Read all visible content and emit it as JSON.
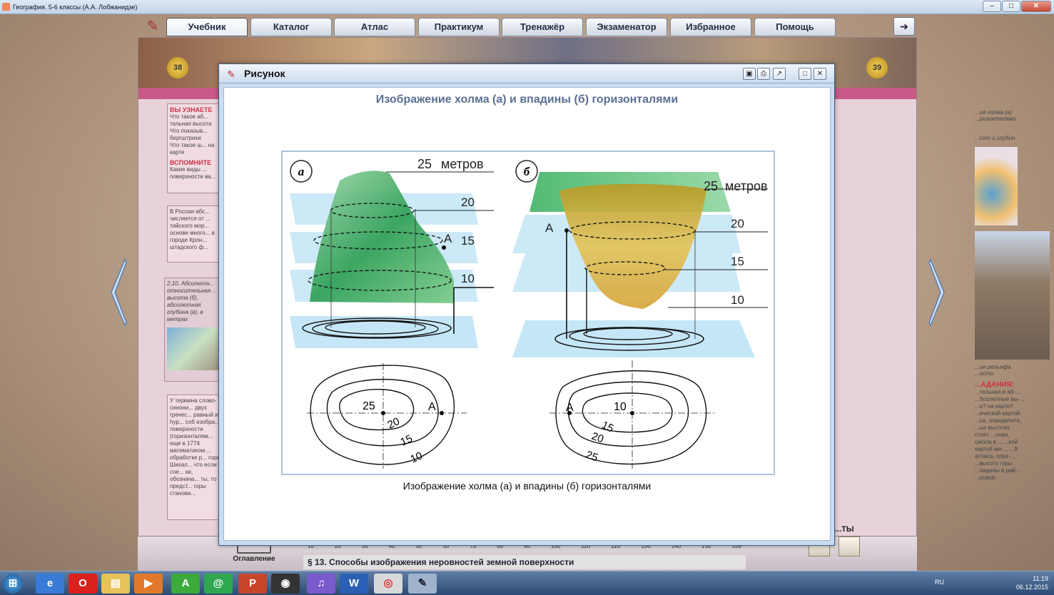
{
  "window": {
    "title": "География. 5-6 классы (А.А. Лобжанидзе)"
  },
  "nav": {
    "tabs": [
      "Учебник",
      "Каталог",
      "Атлас",
      "Практикум",
      "Тренажёр",
      "Экзаменатор",
      "Избранное",
      "Помощь"
    ],
    "active": "Учебник"
  },
  "book": {
    "page_left": "38",
    "page_right": "39",
    "left_texts": {
      "learn_head": "ВЫ УЗНАЕТЕ",
      "learn_items": [
        "Что такое аб... тельная высота",
        "Что показыв... бергштрихи",
        "Что такое ш... на карте"
      ],
      "remember_head": "ВСПОМНИТЕ",
      "remember_item": "Какие виды ... поверхности ва...",
      "box2": "В России абс... числяется от ... тийского мор... основе много... в городе Крон... штадского ф...",
      "box3": "2.10. Абсолютн... относительная ... высота (б), абсолютная глубина (в), в метрах",
      "box4": "У термина слово-синони... двух гречес... равный и hyp... соб изобра... поверхности (горизонталям... еще в 1774 математиком ... обработке р... горы Шихал... что если сое... ки, обознача... ты, то предст... горы станови..."
    },
    "right_texts": {
      "r1": "...ие холма (а) ...ризонталями",
      "r2": "...сот и глубин",
      "r3": "...ие рельефа ...ости",
      "tasks_head": "...АДАНИЯ:",
      "tasks": "...тельная и аб-... ...бсолютные вы-... ...е? на карте? ...ической картой ...са, определите, ...ых высотах стоят ...ново, школа в ... ...кой картой ми-... ...9 атласа, опре-... ...высоту горы ...падины в рай-... ...ровов.",
      "tests": "...ТЫ"
    },
    "toc_label": "Оглавление",
    "section": "§ 13. Способы изображения неровностей земной поверхности",
    "ruler_ticks": [
      "10",
      "20",
      "30",
      "40",
      "50",
      "60",
      "70",
      "80",
      "90",
      "100",
      "110",
      "120",
      "130",
      "140",
      "150",
      "159"
    ]
  },
  "modal": {
    "title": "Рисунок",
    "figure_title": "Изображение холма (а) и впадины (б) горизонталями",
    "caption": "Изображение холма (а) и впадины (б) горизонталями",
    "figure": {
      "panel_a_label": "а",
      "panel_b_label": "б",
      "unit_label": "метров",
      "hill_levels": [
        "25",
        "20",
        "15",
        "10"
      ],
      "basin_levels": [
        "25",
        "20",
        "15",
        "10"
      ],
      "point_label": "А",
      "plan_a": {
        "labels": [
          "25",
          "20",
          "15",
          "10"
        ],
        "point": "А"
      },
      "plan_b": {
        "labels": [
          "10",
          "15",
          "20",
          "25"
        ],
        "point": "А"
      }
    }
  },
  "taskbar": {
    "lang": "RU",
    "time": "11:19",
    "date": "06.12.2015"
  },
  "colors": {
    "accent_pink": "#c75a86",
    "modal_frame": "#3e5f8d",
    "hill": "#2f9f55",
    "basin": "#c9a22d",
    "plane": "#a8d8f0"
  }
}
